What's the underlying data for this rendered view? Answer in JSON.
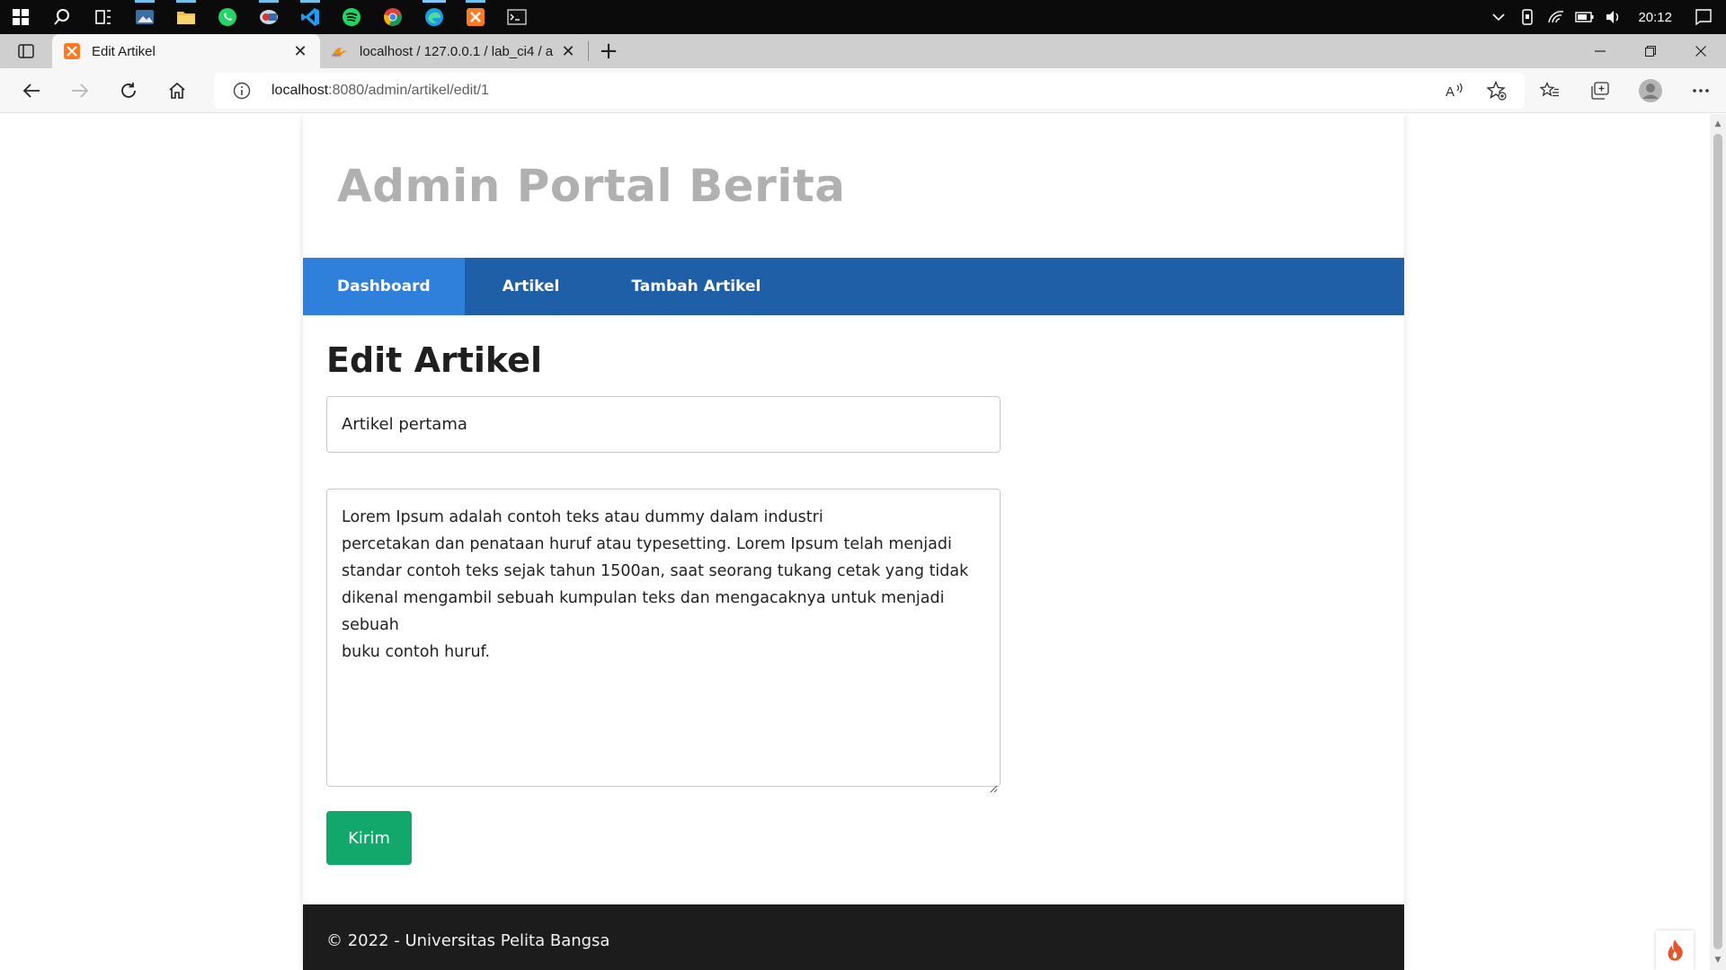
{
  "taskbar": {
    "clock": "20:12",
    "icons": [
      "windows-start-icon",
      "search-icon",
      "task-view-icon",
      "photos-icon",
      "file-explorer-icon",
      "whatsapp-icon",
      "app-icon",
      "vscode-icon",
      "spotify-icon",
      "chrome-icon",
      "edge-icon",
      "xampp-icon",
      "terminal-icon"
    ]
  },
  "browser": {
    "tabs": [
      {
        "title": "Edit Artikel",
        "active": true
      },
      {
        "title": "localhost / 127.0.0.1 / lab_ci4 / a",
        "active": false
      }
    ],
    "url_host": "localhost",
    "url_path": ":8080/admin/artikel/edit/1"
  },
  "site": {
    "title": "Admin Portal Berita",
    "nav": [
      {
        "label": "Dashboard",
        "active": true
      },
      {
        "label": "Artikel",
        "active": false
      },
      {
        "label": "Tambah Artikel",
        "active": false
      }
    ],
    "page_title": "Edit Artikel",
    "form": {
      "judul_value": "Artikel pertama",
      "isi_value": "Lorem Ipsum adalah contoh teks atau dummy dalam industri\npercetakan dan penataan huruf atau typesetting. Lorem Ipsum telah menjadi\nstandar contoh teks sejak tahun 1500an, saat seorang tukang cetak yang tidak\ndikenal mengambil sebuah kumpulan teks dan mengacaknya untuk menjadi\nsebuah\nbuku contoh huruf.",
      "submit_label": "Kirim"
    },
    "footer": "© 2022 - Universitas Pelita Bangsa"
  },
  "colors": {
    "nav_bg": "#1f5fa8",
    "nav_active": "#2f80db",
    "submit": "#13a86b",
    "footer_bg": "#1c1c1c",
    "title": "#b0b0b0"
  }
}
